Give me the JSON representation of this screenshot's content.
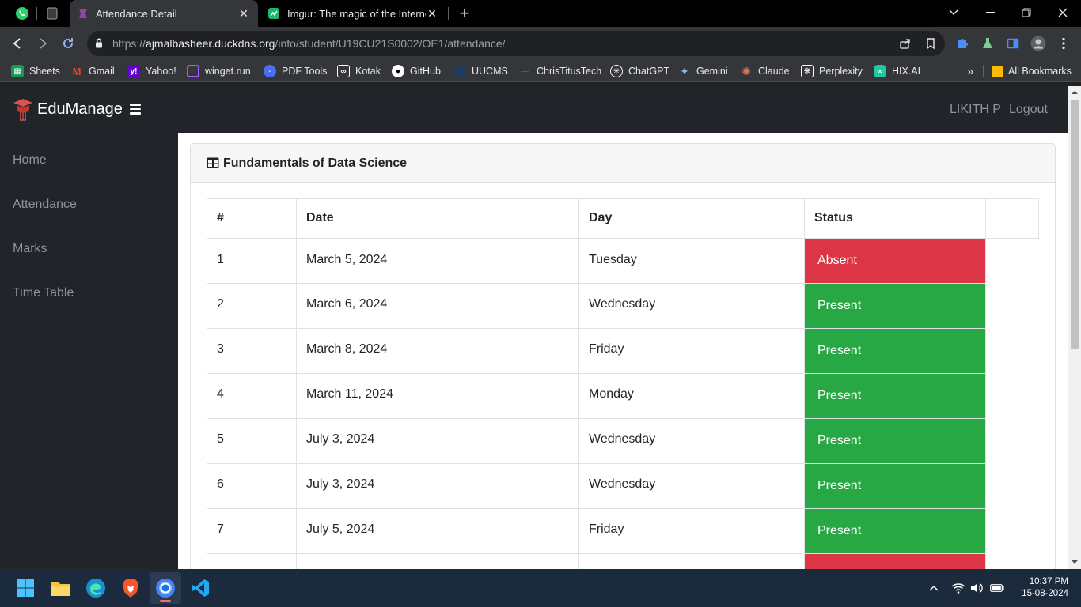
{
  "browser": {
    "tabs": [
      {
        "title": "Attendance Detail",
        "active": true
      },
      {
        "title": "Imgur: The magic of the Internet",
        "active": false
      }
    ],
    "url_scheme": "https://",
    "url_host": "ajmalbasheer.duckdns.org",
    "url_path": "/info/student/U19CU21S0002/OE1/attendance/",
    "bookmarks": [
      {
        "label": "Sheets",
        "icon": "sheets-icon",
        "color": "#0f9d58"
      },
      {
        "label": "Gmail",
        "icon": "gmail-icon",
        "color": "#ea4335"
      },
      {
        "label": "Yahoo!",
        "icon": "yahoo-icon",
        "color": "#6001d2"
      },
      {
        "label": "winget.run",
        "icon": "winget-icon",
        "color": "#a259ff"
      },
      {
        "label": "PDF Tools",
        "icon": "pdf-tools-icon",
        "color": "#4a6cf7"
      },
      {
        "label": "Kotak",
        "icon": "kotak-icon",
        "color": "#ffffff"
      },
      {
        "label": "GitHub",
        "icon": "github-icon",
        "color": "#ffffff"
      },
      {
        "label": "UUCMS",
        "icon": "uucms-icon",
        "color": "#1f3a5f"
      },
      {
        "label": "ChrisTitusTech",
        "icon": "christitustech-icon",
        "color": "#3b5b8c"
      },
      {
        "label": "ChatGPT",
        "icon": "chatgpt-icon",
        "color": "#ffffff"
      },
      {
        "label": "Gemini",
        "icon": "gemini-icon",
        "color": "#8ab4f8"
      },
      {
        "label": "Claude",
        "icon": "claude-icon",
        "color": "#d97757"
      },
      {
        "label": "Perplexity",
        "icon": "perplexity-icon",
        "color": "#ffffff"
      },
      {
        "label": "HIX.AI",
        "icon": "hixai-icon",
        "color": "#20c7a6"
      }
    ],
    "bookmarks_overflow": "»",
    "all_bookmarks": "All Bookmarks"
  },
  "app": {
    "brand": "EduManage",
    "user": "LIKITH P",
    "logout": "Logout",
    "sidebar": [
      {
        "label": "Home"
      },
      {
        "label": "Attendance"
      },
      {
        "label": "Marks"
      },
      {
        "label": "Time Table"
      }
    ]
  },
  "card": {
    "title": "Fundamentals of Data Science",
    "columns": [
      "#",
      "Date",
      "Day",
      "Status"
    ],
    "rows": [
      {
        "num": "1",
        "date": "March 5, 2024",
        "day": "Tuesday",
        "status": "Absent"
      },
      {
        "num": "2",
        "date": "March 6, 2024",
        "day": "Wednesday",
        "status": "Present"
      },
      {
        "num": "3",
        "date": "March 8, 2024",
        "day": "Friday",
        "status": "Present"
      },
      {
        "num": "4",
        "date": "March 11, 2024",
        "day": "Monday",
        "status": "Present"
      },
      {
        "num": "5",
        "date": "July 3, 2024",
        "day": "Wednesday",
        "status": "Present"
      },
      {
        "num": "6",
        "date": "July 3, 2024",
        "day": "Wednesday",
        "status": "Present"
      },
      {
        "num": "7",
        "date": "July 5, 2024",
        "day": "Friday",
        "status": "Present"
      }
    ],
    "status_colors": {
      "Absent": "#dc3545",
      "Present": "#28a745"
    }
  },
  "taskbar": {
    "time": "10:37 PM",
    "date": "15-08-2024"
  }
}
